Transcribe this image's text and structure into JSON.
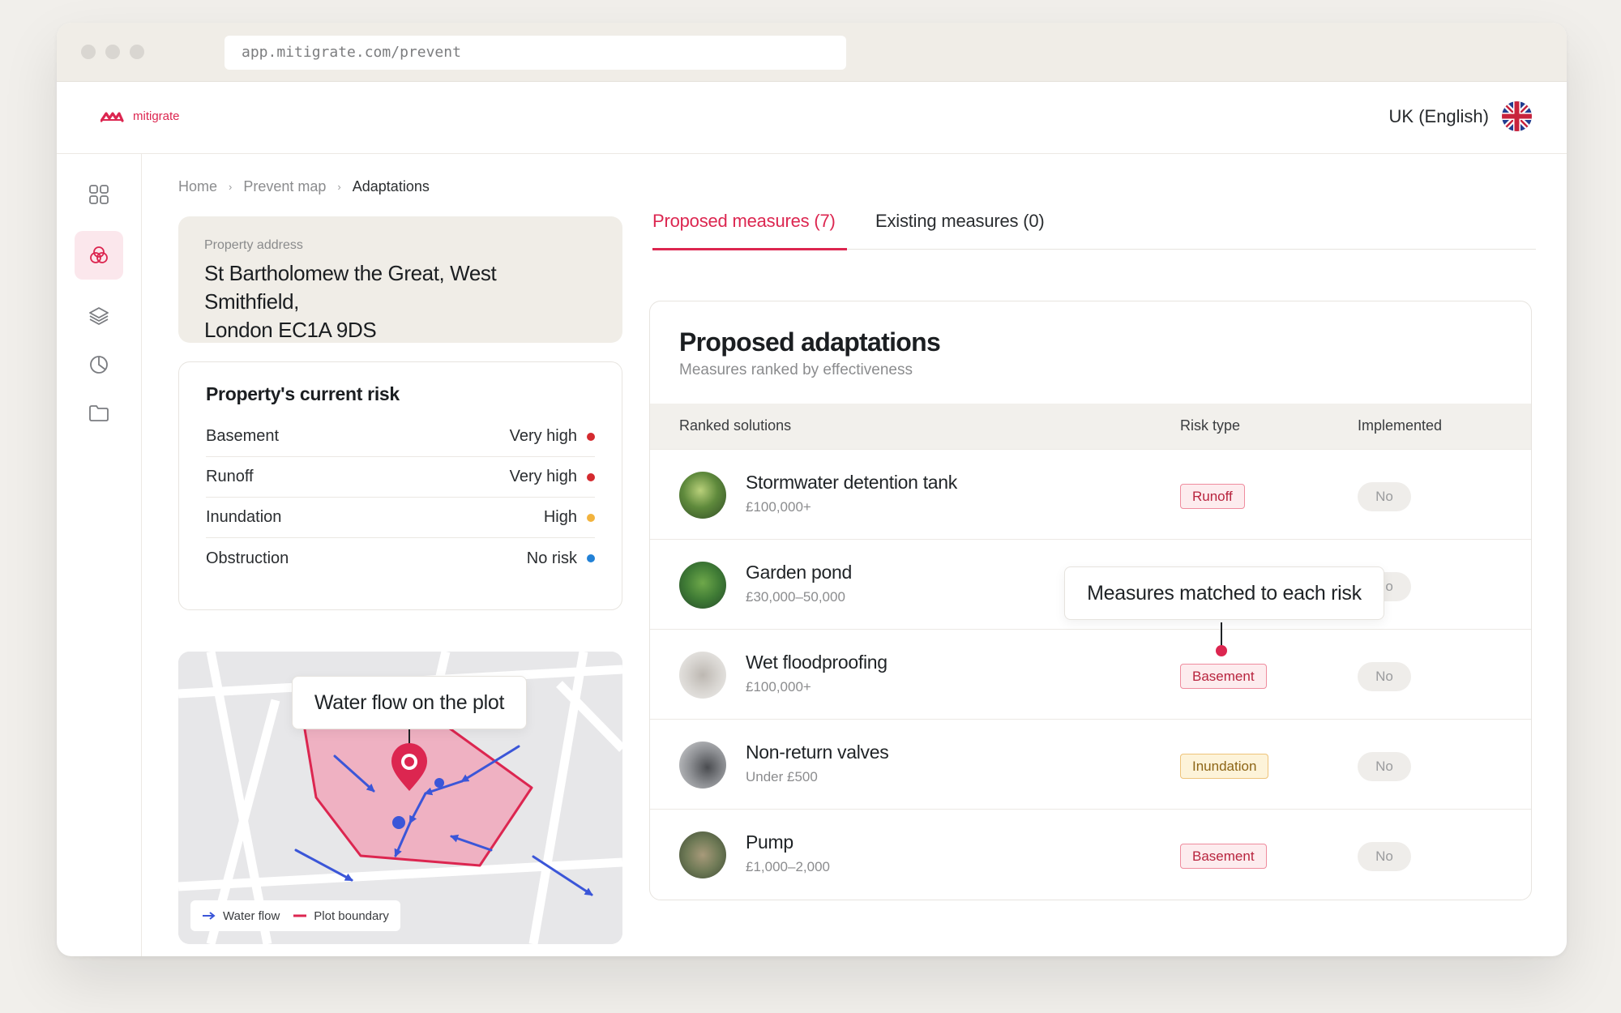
{
  "browser": {
    "url": "app.mitigrate.com/prevent"
  },
  "app": {
    "logo_text": "mitigrate",
    "language": "UK (English)"
  },
  "sidebar": {
    "items": [
      {
        "icon": "grid-icon",
        "active": false
      },
      {
        "icon": "circles-icon",
        "active": true
      },
      {
        "icon": "layers-icon",
        "active": false
      },
      {
        "icon": "pie-chart-icon",
        "active": false
      },
      {
        "icon": "folder-icon",
        "active": false
      }
    ]
  },
  "breadcrumb": {
    "home": "Home",
    "prevent_map": "Prevent map",
    "current": "Adaptations"
  },
  "property": {
    "label": "Property address",
    "address_line1": "St Bartholomew the Great, West Smithfield,",
    "address_line2": "London EC1A 9DS"
  },
  "risk": {
    "title": "Property's current risk",
    "rows": [
      {
        "name": "Basement",
        "level": "Very high",
        "color": "#d42a2f"
      },
      {
        "name": "Runoff",
        "level": "Very high",
        "color": "#d42a2f"
      },
      {
        "name": "Inundation",
        "level": "High",
        "color": "#f2b33d"
      },
      {
        "name": "Obstruction",
        "level": "No risk",
        "color": "#2281d6"
      }
    ]
  },
  "map": {
    "callout": "Water flow on the plot",
    "legend_water": "Water flow",
    "legend_plot": "Plot boundary",
    "flow_color": "#3b56d8",
    "boundary_color": "#dc2650"
  },
  "tabs": {
    "proposed": "Proposed measures (7)",
    "existing": "Existing measures (0)"
  },
  "adaptations": {
    "title": "Proposed adaptations",
    "subtitle": "Measures ranked by effectiveness",
    "col_solutions": "Ranked solutions",
    "col_risk": "Risk type",
    "col_implemented": "Implemented",
    "callout": "Measures matched to each risk",
    "rows": [
      {
        "name": "Stormwater detention tank",
        "cost": "£100,000+",
        "risk": "Runoff",
        "implemented": "No"
      },
      {
        "name": "Garden pond",
        "cost": "£30,000–50,000",
        "risk": "",
        "implemented": "No"
      },
      {
        "name": "Wet floodproofing",
        "cost": "£100,000+",
        "risk": "Basement",
        "implemented": "No"
      },
      {
        "name": "Non-return valves",
        "cost": "Under £500",
        "risk": "Inundation",
        "implemented": "No"
      },
      {
        "name": "Pump",
        "cost": "£1,000–2,000",
        "risk": "Basement",
        "implemented": "No"
      }
    ]
  }
}
